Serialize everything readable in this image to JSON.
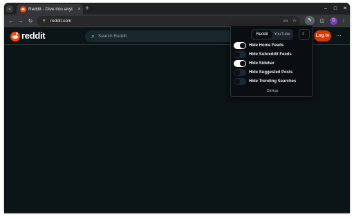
{
  "browser": {
    "tab_title": "Reddit - Dive into anyth",
    "tab_close": "×",
    "new_tab": "+",
    "tab_search": "⌄",
    "url": "reddit.com",
    "window_controls": {
      "minimize": "–",
      "maximize": "□",
      "close": "✕"
    },
    "nav": {
      "back": "←",
      "forward": "→",
      "reload": "↻"
    },
    "profile_initial": "D",
    "menu": "⋮"
  },
  "reddit": {
    "wordmark": "reddit",
    "search_placeholder": "Search Reddit",
    "login_label": "Log In",
    "more_label": "···"
  },
  "popup": {
    "tabs": [
      {
        "label": "Reddit",
        "active": true
      },
      {
        "label": "YouTube",
        "active": false
      }
    ],
    "theme_icon": "☾",
    "options": [
      {
        "label": "Hide Home Feeds",
        "enabled": true
      },
      {
        "label": "Hide Subreddit Feeds",
        "enabled": false
      },
      {
        "label": "Hide Sidebar",
        "enabled": true
      },
      {
        "label": "Hide Suggested Posts",
        "enabled": false
      },
      {
        "label": "Hide Trending Searches",
        "enabled": false
      }
    ],
    "footer_link": "GitHub"
  },
  "colors": {
    "reddit_orange": "#ff4500",
    "login_button": "#d93a00",
    "page_background": "#0b1416"
  }
}
